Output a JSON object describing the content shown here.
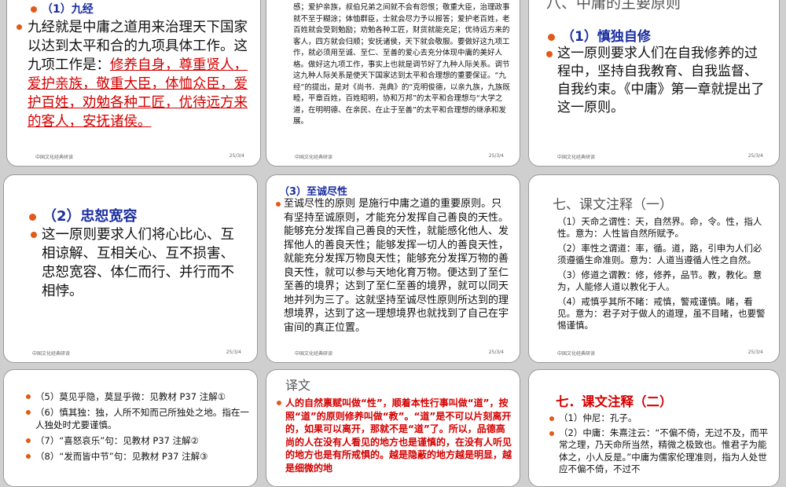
{
  "colors": {
    "accent_red": "#d40000",
    "bullet": "#e05a1a",
    "heading_blue": "#1b2ea0",
    "heading_gray": "#555555"
  },
  "footer": {
    "course": "中国文化经典研读",
    "date": "25/3/4"
  },
  "c1": {
    "head_partial": "（1）九经",
    "text_black": "九经就是中庸之道用来治理天下国家以达到太平和合的九项具体工作。这九项工作是：",
    "text_red": "修养自身，尊重贤人，爱护亲族，敬重大臣，体恤众臣，爱护百姓，劝勉各种工匠，优待远方来的客人，安抚诸侯。"
  },
  "c2": {
    "text": "感；爱护亲族，叔伯兄弟之间就不会有怨恨；敬重大臣，治理政事就不至于糊涂；体恤群臣，士就会尽力予以报答；爱护老百姓，老百姓就会受到勉励；劝勉各种工匠，财货就能充足；优待远方来的客人，四方就会归顺；安抚诸侯，天下就会敬服。要做好这九项工作，就必须用至诚、至仁、至善的爱心去充分体现中庸的美好人格。做好这九项工作，事实上也就是调节好了九种人际关系。调节这九种人际关系是使天下国家达到太平和合理想的重要保证。“九经”的提出，是对《尚书．尧典》的“克明俊德，以亲九族，九族既睦，平章百姓，百姓昭明，协和万邦”的太平和合理想与“大学之道，在明明德、在亲民、在止于至善”的太平和合理想的继承和发展。"
  },
  "c3": {
    "title_partial": "八、中庸的主要原则",
    "subhead": "（1）慎独自修",
    "text": "这一原则要求人们在自我修养的过程中，坚持自我教育、自我监督、自我约束。《中庸》第一章就提出了这一原则。"
  },
  "c4": {
    "subhead": "（2）忠恕宽容",
    "text": "这一原则要求人们将心比心、互相谅解、互相关心、互不损害、忠恕宽容、体仁而行、并行而不相悖。"
  },
  "c5": {
    "subhead": "（3）至诚尽性",
    "text": "至诚尽性的原则  是施行中庸之道的重要原则。只有坚持至诚原则，才能充分发挥自己善良的天性。能够充分发挥自己善良的天性，就能感化他人、发挥他人的善良天性；能够发挥一切人的善良天性，就能充分发挥万物良天性；能够充分发挥万物的善良天性，就可以参与天地化育万物。便达到了至仁至善的境界；达到了至仁至善的境界，就可以同天地并列为三了。这就坚持至诚尽性原则所达到的理想境界，达到了这一理想境界也就找到了自己在宇宙间的真正位置。"
  },
  "c6": {
    "title": "七、课文注释（一）",
    "notes": [
      "（1）天命之谓性：天，自然界。命，令。性，指人性。意为：人性皆自然所赋予。",
      "（2）率性之谓道：率，循。道，路，引申为人们必须遵循生命准则。意为：人道当遵循人性之自然。",
      "（3）修道之谓教：修，修养，品节。教，教化。意为，人能修人道以教化于人。",
      "（4）戒慎乎其所不睹：戒慎，警戒谨慎。睹，看见。意为：君子对于做人的道理，虽不目睹，也要警惕谨慎。"
    ]
  },
  "c7": {
    "notes": [
      "（5）莫见乎隐，莫显乎微：见教材 P37 注解①",
      "（6）慎其独：独，人所不知而己所独处之地。指在一人独处时尤要谨慎。",
      "（7）“喜怒哀乐”句：见教材 P37 注解②",
      "（8）“发而皆中节”句：见教材 P37 注解③"
    ]
  },
  "c8": {
    "title": "译文",
    "text": "人的自然禀赋叫做“性”，顺着本性行事叫做“道”，按照“道”的原则修养叫做“教”。“道”是不可以片刻离开的，如果可以离开，那就不是“道”了。所以，品德高尚的人在没有人看见的地方也是谨慎的，在没有人听见的地方也是有所戒惧的。越是隐蔽的地方越是明显，越是细微的地"
  },
  "c9": {
    "title": "七．课文注释（二）",
    "notes": [
      "（1）仲尼：孔子。",
      "（2）中庸：朱熹注云：“不偏不倚，无过不及，而平常之理，乃天命所当然，精微之极致也。惟君子为能体之，小人反是。”中庸为儒家伦理准则，指为人处世应不偏不倚，不过不"
    ]
  }
}
